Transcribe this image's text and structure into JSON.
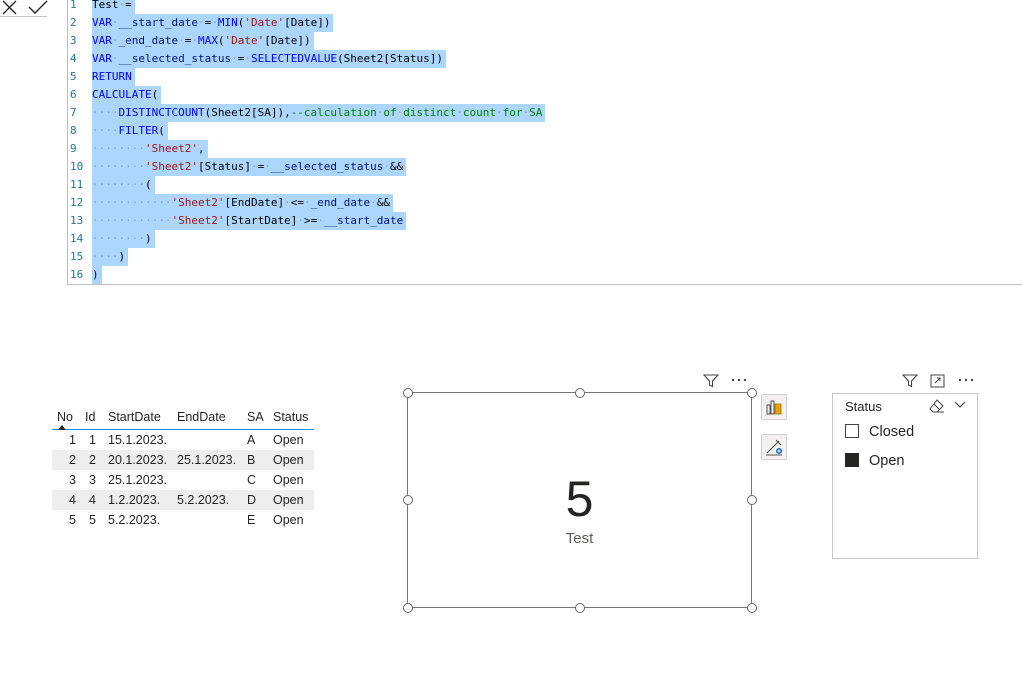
{
  "formula_bar": {
    "cancel_icon": "x-icon",
    "commit_icon": "checkmark-icon",
    "lines": [
      {
        "n": "1",
        "html": "Test<span class=\"ws\">·</span>="
      },
      {
        "n": "2",
        "html": "<span class=\"kw\">VAR</span><span class=\"ws\">·</span><span class=\"var\">__start_date</span><span class=\"ws\">·</span>=<span class=\"ws\">·</span><span class=\"fn\">MIN</span>(<span class=\"str\">'Date'</span>[Date])"
      },
      {
        "n": "3",
        "html": "<span class=\"kw\">VAR</span><span class=\"ws\">·</span><span class=\"var\">_end_date</span><span class=\"ws\">·</span>=<span class=\"ws\">·</span><span class=\"fn\">MAX</span>(<span class=\"str\">'Date'</span>[Date])"
      },
      {
        "n": "4",
        "html": "<span class=\"kw\">VAR</span><span class=\"ws\">·</span><span class=\"var\">__selected_status</span><span class=\"ws\">·</span>=<span class=\"ws\">·</span><span class=\"fn\">SELECTEDVALUE</span>(Sheet2[Status])"
      },
      {
        "n": "5",
        "html": "<span class=\"kw\">RETURN</span>"
      },
      {
        "n": "6",
        "html": "<span class=\"fn\">CALCULATE</span>("
      },
      {
        "n": "7",
        "html": "<span class=\"ws\">····</span><span class=\"fn\">DISTINCTCOUNT</span>(Sheet2[SA]),<span class=\"cm\">--calculation<span class=\"ws\">·</span>of<span class=\"ws\">·</span>distinct<span class=\"ws\">·</span>count<span class=\"ws\">·</span>for<span class=\"ws\">·</span>SA</span>"
      },
      {
        "n": "8",
        "html": "<span class=\"ws\">····</span><span class=\"fn\">FILTER</span>("
      },
      {
        "n": "9",
        "html": "<span class=\"ws\">········</span><span class=\"str\">'Sheet2'</span>,"
      },
      {
        "n": "10",
        "html": "<span class=\"ws\">········</span><span class=\"str\">'Sheet2'</span>[Status]<span class=\"ws\">·</span>=<span class=\"ws\">·</span><span class=\"var\">__selected_status</span><span class=\"ws\">·</span>&amp;&amp;"
      },
      {
        "n": "11",
        "html": "<span class=\"ws\">········</span>("
      },
      {
        "n": "12",
        "html": "<span class=\"ws\">············</span><span class=\"str\">'Sheet2'</span>[EndDate]<span class=\"ws\">·</span>&lt;=<span class=\"ws\">·</span><span class=\"var\">_end_date</span><span class=\"ws\">·</span>&amp;&amp;"
      },
      {
        "n": "13",
        "html": "<span class=\"ws\">············</span><span class=\"str\">'Sheet2'</span>[StartDate]<span class=\"ws\">·</span>&gt;=<span class=\"ws\">·</span><span class=\"var\">__start_date</span>"
      },
      {
        "n": "14",
        "html": "<span class=\"ws\">········</span>)"
      },
      {
        "n": "15",
        "html": "<span class=\"ws\">····</span>)"
      },
      {
        "n": "16",
        "html": ")"
      }
    ]
  },
  "table": {
    "headers": [
      "No",
      "Id",
      "StartDate",
      "EndDate",
      "SA",
      "Status"
    ],
    "rows": [
      [
        "1",
        "1",
        "15.1.2023.",
        "",
        "A",
        "Open"
      ],
      [
        "2",
        "2",
        "20.1.2023.",
        "25.1.2023.",
        "B",
        "Open"
      ],
      [
        "3",
        "3",
        "25.1.2023.",
        "",
        "C",
        "Open"
      ],
      [
        "4",
        "4",
        "1.2.2023.",
        "5.2.2023.",
        "D",
        "Open"
      ],
      [
        "5",
        "5",
        "5.2.2023.",
        "",
        "E",
        "Open"
      ]
    ]
  },
  "card": {
    "value": "5",
    "label": "Test",
    "header_icons": [
      "filter-icon",
      "more-options-icon"
    ],
    "side_buttons": [
      "format-visual-icon",
      "analytics-icon"
    ]
  },
  "slicer": {
    "title": "Status",
    "header_icons": [
      "filter-icon",
      "focus-mode-icon",
      "more-options-icon",
      "eraser-icon",
      "chevron-down-icon"
    ],
    "items": [
      {
        "label": "Closed",
        "checked": false
      },
      {
        "label": "Open",
        "checked": true
      }
    ]
  }
}
